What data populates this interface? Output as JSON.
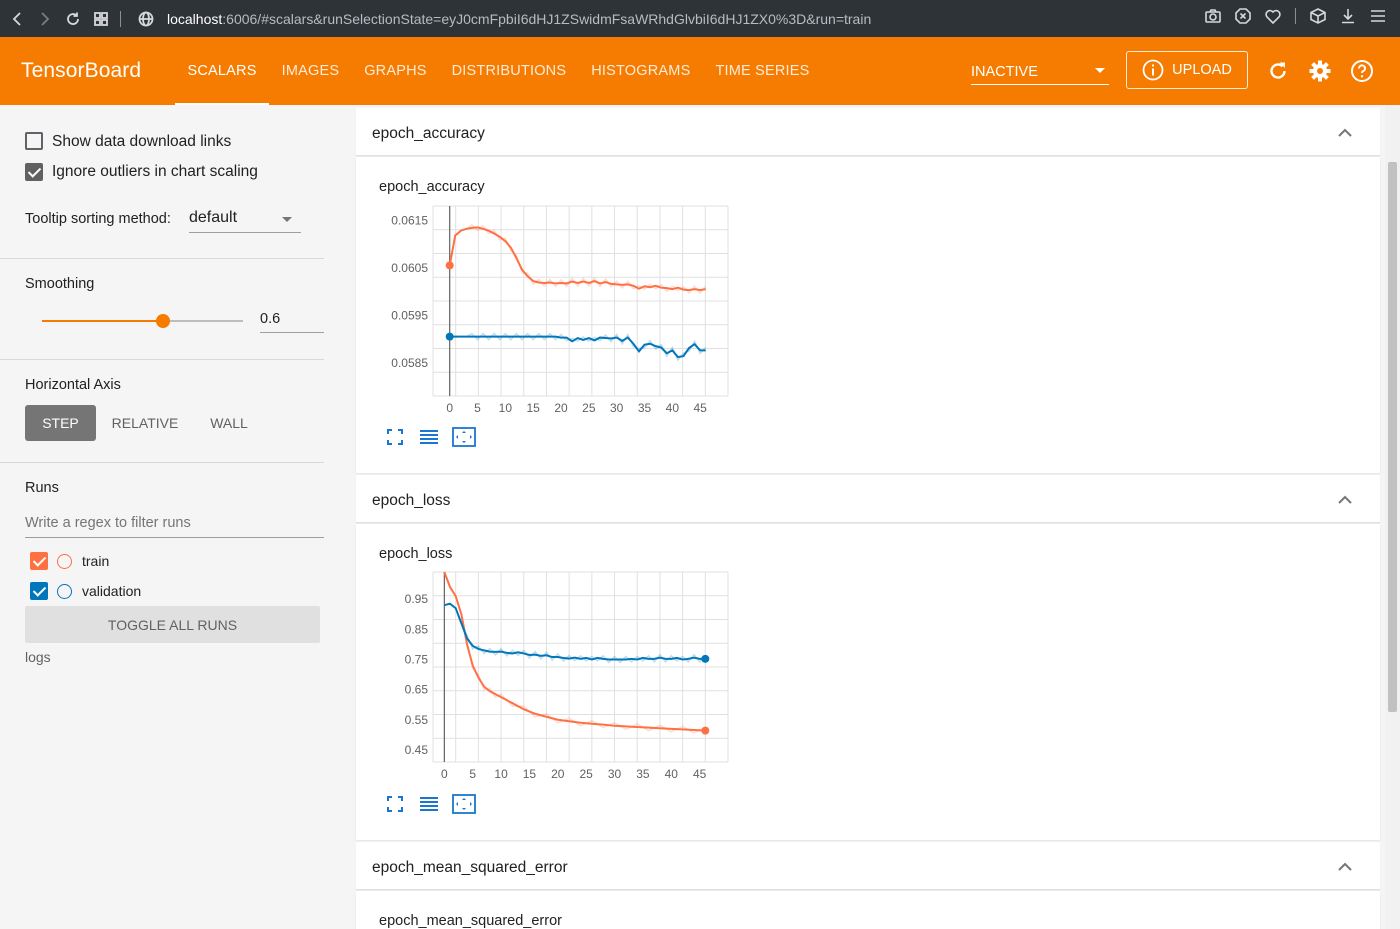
{
  "browser": {
    "url_host": "localhost",
    "url_rest": ":6006/#scalars&runSelectionState=eyJ0cmFpbiI6dHJ1ZSwidmFsaWRhdGlvbiI6dHJ1ZX0%3D&run=train"
  },
  "appbar": {
    "brand": "TensorBoard",
    "tabs": [
      {
        "label": "SCALARS",
        "active": true
      },
      {
        "label": "IMAGES"
      },
      {
        "label": "GRAPHS"
      },
      {
        "label": "DISTRIBUTIONS"
      },
      {
        "label": "HISTOGRAMS"
      },
      {
        "label": "TIME SERIES"
      }
    ],
    "reload_state": "INACTIVE",
    "upload_label": "UPLOAD",
    "accent_color": "#f57c00"
  },
  "sidebar": {
    "show_download_links": {
      "label": "Show data download links",
      "checked": false
    },
    "ignore_outliers": {
      "label": "Ignore outliers in chart scaling",
      "checked": true
    },
    "tooltip_sort": {
      "label": "Tooltip sorting method:",
      "value": "default"
    },
    "smoothing": {
      "label": "Smoothing",
      "value": "0.6",
      "fraction": 0.6
    },
    "horizontal_axis": {
      "label": "Horizontal Axis",
      "options": [
        "STEP",
        "RELATIVE",
        "WALL"
      ],
      "selected": "STEP"
    },
    "runs": {
      "label": "Runs",
      "filter_placeholder": "Write a regex to filter runs",
      "items": [
        {
          "name": "train",
          "color": "#ff7043",
          "checked": true
        },
        {
          "name": "validation",
          "color": "#0077bb",
          "checked": true
        }
      ],
      "toggle_label": "TOGGLE ALL RUNS",
      "logdir": "logs"
    }
  },
  "cards": [
    {
      "header": "epoch_accuracy",
      "chart_title": "epoch_accuracy"
    },
    {
      "header": "epoch_loss",
      "chart_title": "epoch_loss"
    },
    {
      "header": "epoch_mean_squared_error",
      "chart_title": "epoch_mean_squared_error"
    }
  ],
  "chart_data": [
    {
      "type": "line",
      "title": "epoch_accuracy",
      "xlim": [
        -3,
        50
      ],
      "ylim": [
        0.0578,
        0.0618
      ],
      "x_ticks": [
        0,
        5,
        10,
        15,
        20,
        25,
        30,
        35,
        40,
        45
      ],
      "y_ticks": [
        0.0585,
        0.0595,
        0.0605,
        0.0615
      ],
      "grid": true,
      "series": [
        {
          "name": "train",
          "color": "#ff7043",
          "x": [
            0,
            1,
            2,
            3,
            4,
            5,
            6,
            7,
            8,
            9,
            10,
            11,
            12,
            13,
            14,
            15,
            16,
            17,
            18,
            19,
            20,
            21,
            22,
            23,
            24,
            25,
            26,
            27,
            28,
            29,
            30,
            31,
            32,
            33,
            34,
            35,
            36,
            37,
            38,
            39,
            40,
            41,
            42,
            43,
            44,
            45,
            46
          ],
          "y": [
            0.06055,
            0.06118,
            0.06128,
            0.06132,
            0.06134,
            0.06135,
            0.06132,
            0.06128,
            0.06122,
            0.06115,
            0.06106,
            0.06092,
            0.0607,
            0.06046,
            0.06032,
            0.06022,
            0.06019,
            0.06018,
            0.06019,
            0.06017,
            0.06018,
            0.06017,
            0.06021,
            0.06018,
            0.06021,
            0.06018,
            0.06022,
            0.06017,
            0.0602,
            0.06016,
            0.06015,
            0.06014,
            0.06015,
            0.06012,
            0.06006,
            0.06011,
            0.06009,
            0.06012,
            0.06008,
            0.06007,
            0.06005,
            0.06008,
            0.06004,
            0.06003,
            0.06005,
            0.06003,
            0.06005
          ]
        },
        {
          "name": "validation",
          "color": "#0077bb",
          "x": [
            0,
            1,
            2,
            3,
            4,
            5,
            6,
            7,
            8,
            9,
            10,
            11,
            12,
            13,
            14,
            15,
            16,
            17,
            18,
            19,
            20,
            21,
            22,
            23,
            24,
            25,
            26,
            27,
            28,
            29,
            30,
            31,
            32,
            33,
            34,
            35,
            36,
            37,
            38,
            39,
            40,
            41,
            42,
            43,
            44,
            45,
            46
          ],
          "y": [
            0.05905,
            0.05905,
            0.05905,
            0.05905,
            0.05905,
            0.05905,
            0.05905,
            0.05905,
            0.05905,
            0.05905,
            0.05905,
            0.05905,
            0.05905,
            0.05905,
            0.05905,
            0.05905,
            0.05905,
            0.05905,
            0.05905,
            0.05905,
            0.05903,
            0.05903,
            0.05895,
            0.05902,
            0.05898,
            0.05902,
            0.05897,
            0.05903,
            0.05902,
            0.05901,
            0.05903,
            0.05896,
            0.05903,
            0.0589,
            0.05874,
            0.05888,
            0.0589,
            0.05885,
            0.05882,
            0.0587,
            0.05876,
            0.05862,
            0.05864,
            0.05881,
            0.05889,
            0.05876,
            0.05876
          ]
        }
      ]
    },
    {
      "type": "line",
      "title": "epoch_loss",
      "xlim": [
        -2,
        50
      ],
      "ylim": [
        0.41,
        1.04
      ],
      "x_ticks": [
        0,
        5,
        10,
        15,
        20,
        25,
        30,
        35,
        40,
        45
      ],
      "y_ticks": [
        0.45,
        0.55,
        0.65,
        0.75,
        0.85,
        0.95
      ],
      "grid": true,
      "series": [
        {
          "name": "train",
          "color": "#ff7043",
          "x": [
            0,
            1,
            2,
            3,
            4,
            5,
            6,
            7,
            8,
            9,
            10,
            12,
            14,
            16,
            18,
            20,
            22,
            24,
            26,
            28,
            30,
            32,
            34,
            36,
            38,
            40,
            42,
            44,
            46
          ],
          "y": [
            1.04,
            0.99,
            0.96,
            0.9,
            0.8,
            0.73,
            0.69,
            0.66,
            0.645,
            0.635,
            0.625,
            0.605,
            0.585,
            0.57,
            0.56,
            0.55,
            0.545,
            0.54,
            0.537,
            0.534,
            0.53,
            0.528,
            0.526,
            0.524,
            0.522,
            0.52,
            0.518,
            0.516,
            0.514
          ]
        },
        {
          "name": "validation",
          "color": "#0077bb",
          "x": [
            0,
            1,
            2,
            3,
            4,
            5,
            6,
            7,
            8,
            9,
            10,
            11,
            12,
            13,
            14,
            15,
            16,
            17,
            18,
            19,
            20,
            21,
            22,
            23,
            24,
            25,
            26,
            27,
            28,
            29,
            30,
            31,
            32,
            33,
            34,
            35,
            36,
            37,
            38,
            39,
            40,
            41,
            42,
            43,
            44,
            45,
            46
          ],
          "y": [
            0.93,
            0.935,
            0.92,
            0.87,
            0.82,
            0.795,
            0.785,
            0.78,
            0.776,
            0.775,
            0.776,
            0.772,
            0.77,
            0.774,
            0.77,
            0.765,
            0.766,
            0.762,
            0.764,
            0.758,
            0.758,
            0.755,
            0.753,
            0.756,
            0.752,
            0.755,
            0.75,
            0.755,
            0.752,
            0.75,
            0.75,
            0.75,
            0.75,
            0.752,
            0.75,
            0.755,
            0.752,
            0.752,
            0.756,
            0.752,
            0.752,
            0.755,
            0.75,
            0.752,
            0.756,
            0.752,
            0.752
          ]
        }
      ]
    }
  ]
}
